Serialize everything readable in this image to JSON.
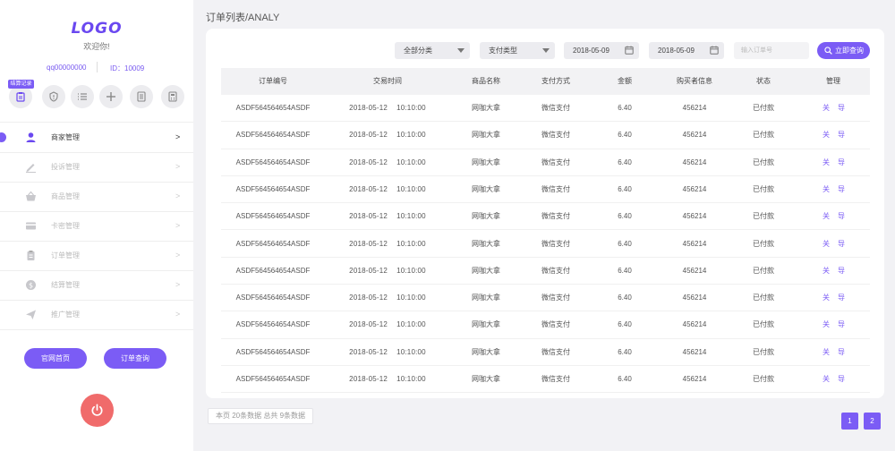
{
  "sidebar": {
    "logo": "LOGO",
    "welcome": "欢迎你!",
    "user_qq": "qq00000000",
    "user_id": "ID：10009",
    "quick_tag": "结算记录",
    "menu": [
      {
        "label": "商家管理",
        "arrow": ">",
        "icon": "user-icon",
        "active": true
      },
      {
        "label": "投诉管理",
        "arrow": ">",
        "icon": "pencil-icon",
        "active": false
      },
      {
        "label": "商品管理",
        "arrow": ">",
        "icon": "basket-icon",
        "active": false
      },
      {
        "label": "卡密管理",
        "arrow": ">",
        "icon": "card-icon",
        "active": false
      },
      {
        "label": "订单管理",
        "arrow": ">",
        "icon": "clipboard-icon",
        "active": false
      },
      {
        "label": "结算管理",
        "arrow": ">",
        "icon": "coin-icon",
        "active": false
      },
      {
        "label": "推广管理",
        "arrow": ">",
        "icon": "send-icon",
        "active": false
      }
    ],
    "btn_home": "官网首页",
    "btn_orders": "订单查询"
  },
  "page_title": "订单列表/ANALY",
  "filters": {
    "category": "全部分类",
    "pay_type": "支付类型",
    "date_from": "2018-05-09",
    "date_to": "2018-05-09",
    "order_placeholder": "输入订单号",
    "search_label": "立即查询"
  },
  "table": {
    "headers": [
      "订单编号",
      "交易时间",
      "商品名称",
      "支付方式",
      "金额",
      "购买者信息",
      "状态",
      "管理"
    ],
    "rows": [
      {
        "id": "ASDF564564654ASDF",
        "date": "2018-05-12",
        "time": "10:10:00",
        "product": "网咖大拿",
        "pay": "微信支付",
        "amount": "6.40",
        "buyer": "456214",
        "status": "已付款",
        "act1": "关",
        "act2": "导"
      },
      {
        "id": "ASDF564564654ASDF",
        "date": "2018-05-12",
        "time": "10:10:00",
        "product": "网咖大拿",
        "pay": "微信支付",
        "amount": "6.40",
        "buyer": "456214",
        "status": "已付款",
        "act1": "关",
        "act2": "导"
      },
      {
        "id": "ASDF564564654ASDF",
        "date": "2018-05-12",
        "time": "10:10:00",
        "product": "网咖大拿",
        "pay": "微信支付",
        "amount": "6.40",
        "buyer": "456214",
        "status": "已付款",
        "act1": "关",
        "act2": "导"
      },
      {
        "id": "ASDF564564654ASDF",
        "date": "2018-05-12",
        "time": "10:10:00",
        "product": "网咖大拿",
        "pay": "微信支付",
        "amount": "6.40",
        "buyer": "456214",
        "status": "已付款",
        "act1": "关",
        "act2": "导"
      },
      {
        "id": "ASDF564564654ASDF",
        "date": "2018-05-12",
        "time": "10:10:00",
        "product": "网咖大拿",
        "pay": "微信支付",
        "amount": "6.40",
        "buyer": "456214",
        "status": "已付款",
        "act1": "关",
        "act2": "导"
      },
      {
        "id": "ASDF564564654ASDF",
        "date": "2018-05-12",
        "time": "10:10:00",
        "product": "网咖大拿",
        "pay": "微信支付",
        "amount": "6.40",
        "buyer": "456214",
        "status": "已付款",
        "act1": "关",
        "act2": "导"
      },
      {
        "id": "ASDF564564654ASDF",
        "date": "2018-05-12",
        "time": "10:10:00",
        "product": "网咖大拿",
        "pay": "微信支付",
        "amount": "6.40",
        "buyer": "456214",
        "status": "已付款",
        "act1": "关",
        "act2": "导"
      },
      {
        "id": "ASDF564564654ASDF",
        "date": "2018-05-12",
        "time": "10:10:00",
        "product": "网咖大拿",
        "pay": "微信支付",
        "amount": "6.40",
        "buyer": "456214",
        "status": "已付款",
        "act1": "关",
        "act2": "导"
      },
      {
        "id": "ASDF564564654ASDF",
        "date": "2018-05-12",
        "time": "10:10:00",
        "product": "网咖大拿",
        "pay": "微信支付",
        "amount": "6.40",
        "buyer": "456214",
        "status": "已付款",
        "act1": "关",
        "act2": "导"
      },
      {
        "id": "ASDF564564654ASDF",
        "date": "2018-05-12",
        "time": "10:10:00",
        "product": "网咖大拿",
        "pay": "微信支付",
        "amount": "6.40",
        "buyer": "456214",
        "status": "已付款",
        "act1": "关",
        "act2": "导"
      },
      {
        "id": "ASDF564564654ASDF",
        "date": "2018-05-12",
        "time": "10:10:00",
        "product": "网咖大拿",
        "pay": "微信支付",
        "amount": "6.40",
        "buyer": "456214",
        "status": "已付款",
        "act1": "关",
        "act2": "导"
      }
    ]
  },
  "footer": {
    "info": "本页 20条数据 总共 9条数据",
    "pages": [
      "1",
      "2"
    ]
  },
  "colors": {
    "accent": "#7b5cf5",
    "power": "#f06b6b",
    "background": "#f2f2f5"
  }
}
